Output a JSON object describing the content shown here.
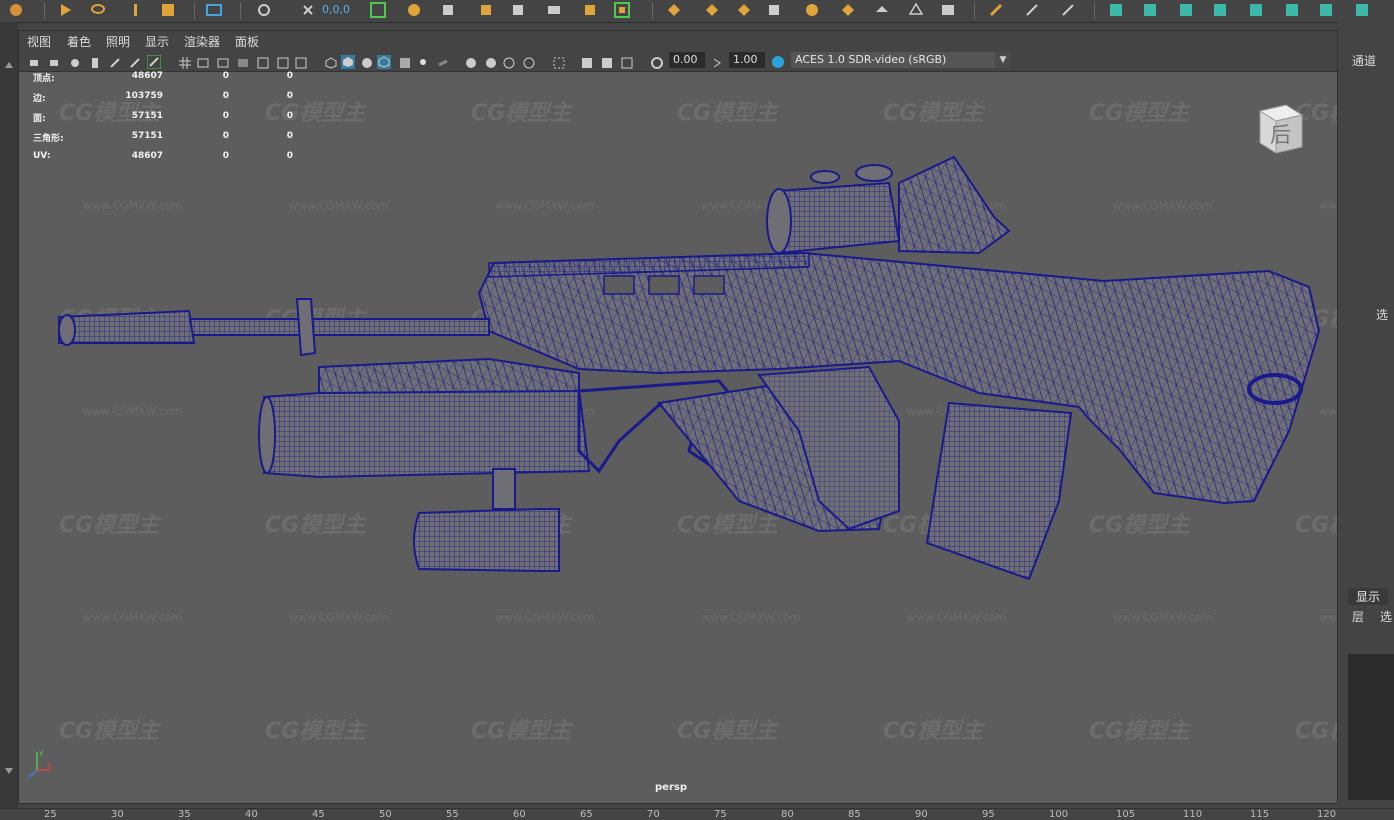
{
  "panel_menu": [
    "视图",
    "着色",
    "照明",
    "显示",
    "渲染器",
    "面板"
  ],
  "toolbar": {
    "coord_readout": "0,0,0",
    "exposure": "0.00",
    "gamma": "1.00",
    "color_space": "ACES 1.0 SDR-video (sRGB)"
  },
  "hud": {
    "rows": [
      {
        "label": "顶点:",
        "v1": "48607",
        "v2": "0",
        "v3": "0"
      },
      {
        "label": "边:",
        "v1": "103759",
        "v2": "0",
        "v3": "0"
      },
      {
        "label": "面:",
        "v1": "57151",
        "v2": "0",
        "v3": "0"
      },
      {
        "label": "三角形:",
        "v1": "57151",
        "v2": "0",
        "v3": "0"
      },
      {
        "label": "UV:",
        "v1": "48607",
        "v2": "0",
        "v3": "0"
      }
    ]
  },
  "viewcube_label": "后",
  "camera_label": "persp",
  "axis": {
    "x": "x",
    "y": "y",
    "z": "z"
  },
  "watermark": {
    "logo": "CG模型主",
    "url": "www.CGMXW.com"
  },
  "right_panel": {
    "channel": "通道",
    "side_label": "选",
    "display_tab": "显示",
    "layer": "层",
    "select": "选"
  },
  "ruler_ticks": [
    "25",
    "30",
    "35",
    "40",
    "45",
    "50",
    "55",
    "60",
    "65",
    "70",
    "75",
    "80",
    "85",
    "90",
    "95",
    "100",
    "105",
    "110",
    "115",
    "120"
  ],
  "colors": {
    "wireframe": "#1a1a8c",
    "model_fill": "#6e6e74",
    "viewport_bg": "#5d5d5d",
    "accent": "#2aa3dd"
  }
}
